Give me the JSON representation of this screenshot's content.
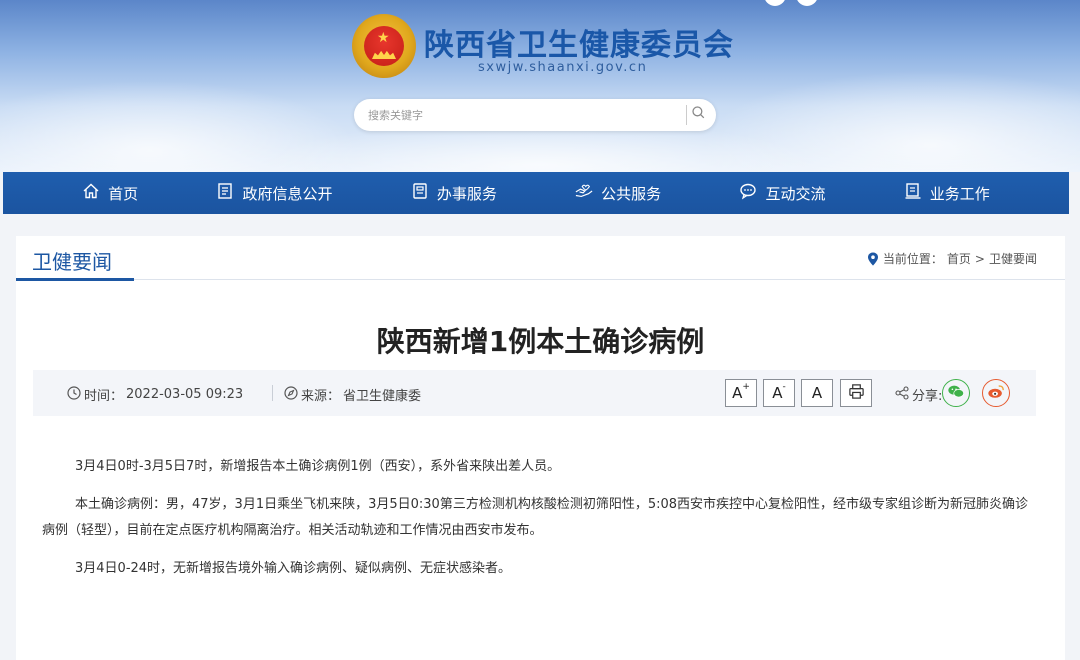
{
  "site": {
    "title": "陕西省卫生健康委员会",
    "domain": "sxwjw.shaanxi.gov.cn"
  },
  "search": {
    "placeholder": "搜索关键字",
    "icon": "search-icon"
  },
  "nav": {
    "items": [
      {
        "label": "首页",
        "icon": "home-icon"
      },
      {
        "label": "政府信息公开",
        "icon": "document-icon"
      },
      {
        "label": "办事服务",
        "icon": "service-icon"
      },
      {
        "label": "公共服务",
        "icon": "hands-icon"
      },
      {
        "label": "互动交流",
        "icon": "chat-icon"
      },
      {
        "label": "业务工作",
        "icon": "work-icon"
      }
    ]
  },
  "section": {
    "title": "卫健要闻"
  },
  "breadcrumb": {
    "prefix": "当前位置：",
    "home": "首页",
    "separator": ">",
    "current": "卫健要闻"
  },
  "article": {
    "title": "陕西新增1例本土确诊病例",
    "time_label": "时间：",
    "time": "2022-03-05 09:23",
    "source_label": "来源：",
    "source": "省卫生健康委",
    "font_larger": "A",
    "font_smaller": "A",
    "font_reset": "A",
    "share_label": "分享:",
    "paragraphs": [
      "3月4日0时-3月5日7时，新增报告本土确诊病例1例（西安），系外省来陕出差人员。",
      "本土确诊病例：男，47岁，3月1日乘坐飞机来陕，3月5日0:30第三方检测机构核酸检测初筛阳性，5:08西安市疾控中心复检阳性，经市级专家组诊断为新冠肺炎确诊病例（轻型），目前在定点医疗机构隔离治疗。相关活动轨迹和工作情况由西安市发布。",
      "3月4日0-24时，无新增报告境外输入确诊病例、疑似病例、无症状感染者。"
    ]
  },
  "colors": {
    "nav_bg": "#1f5eae",
    "title_blue": "#1a57a8",
    "wechat_green": "#3fb14a",
    "weibo_red": "#e65a2f"
  }
}
